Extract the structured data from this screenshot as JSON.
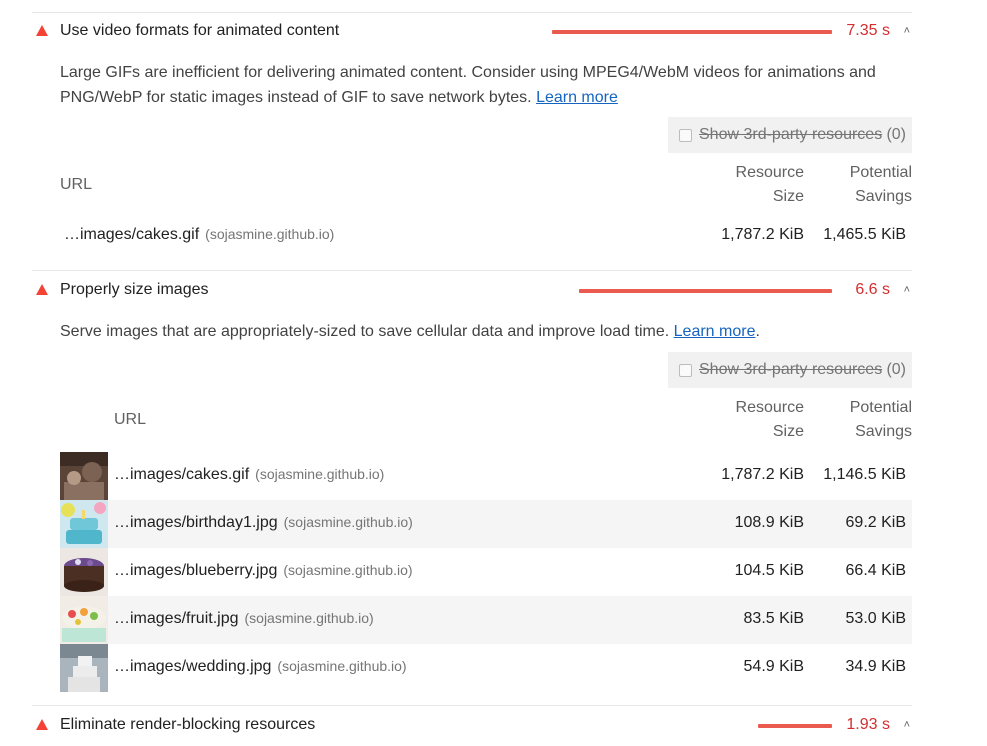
{
  "colors": {
    "fail": "#f44336",
    "bar": "#eb5a4e",
    "value": "#d32f2f",
    "link": "#1565c0"
  },
  "audits": [
    {
      "title": "Use video formats for animated content",
      "value": "7.35 s",
      "desc_text": "Large GIFs are inefficient for delivering animated content. Consider using MPEG4/WebM videos for animations and PNG/WebP for static images instead of GIF to save network bytes.",
      "learn_more": "Learn more",
      "third_party_label": "Show 3rd-party resources",
      "third_party_count": "(0)",
      "col_url": "URL",
      "col_size_1": "Resource",
      "col_size_2": "Size",
      "col_save_1": "Potential",
      "col_save_2": "Savings",
      "rows": [
        {
          "url": "…images/cakes.gif",
          "host": "(sojasmine.github.io)",
          "size": "1,787.2 KiB",
          "savings": "1,465.5 KiB"
        }
      ]
    },
    {
      "title": "Properly size images",
      "value": "6.6 s",
      "desc_text": "Serve images that are appropriately-sized to save cellular data and improve load time.",
      "learn_more": "Learn more",
      "desc_end": ".",
      "third_party_label": "Show 3rd-party resources",
      "third_party_count": "(0)",
      "col_url": "URL",
      "col_size_1": "Resource",
      "col_size_2": "Size",
      "col_save_1": "Potential",
      "col_save_2": "Savings",
      "rows": [
        {
          "url": "…images/cakes.gif",
          "host": "(sojasmine.github.io)",
          "size": "1,787.2 KiB",
          "savings": "1,146.5 KiB",
          "thumb": "cakes-thumbnail"
        },
        {
          "url": "…images/birthday1.jpg",
          "host": "(sojasmine.github.io)",
          "size": "108.9 KiB",
          "savings": "69.2 KiB",
          "thumb": "birthday-cake-thumbnail"
        },
        {
          "url": "…images/blueberry.jpg",
          "host": "(sojasmine.github.io)",
          "size": "104.5 KiB",
          "savings": "66.4 KiB",
          "thumb": "blueberry-cake-thumbnail"
        },
        {
          "url": "…images/fruit.jpg",
          "host": "(sojasmine.github.io)",
          "size": "83.5 KiB",
          "savings": "53.0 KiB",
          "thumb": "fruit-cake-thumbnail"
        },
        {
          "url": "…images/wedding.jpg",
          "host": "(sojasmine.github.io)",
          "size": "54.9 KiB",
          "savings": "34.9 KiB",
          "thumb": "wedding-cake-thumbnail"
        }
      ]
    },
    {
      "title": "Eliminate render-blocking resources",
      "value": "1.93 s"
    }
  ]
}
